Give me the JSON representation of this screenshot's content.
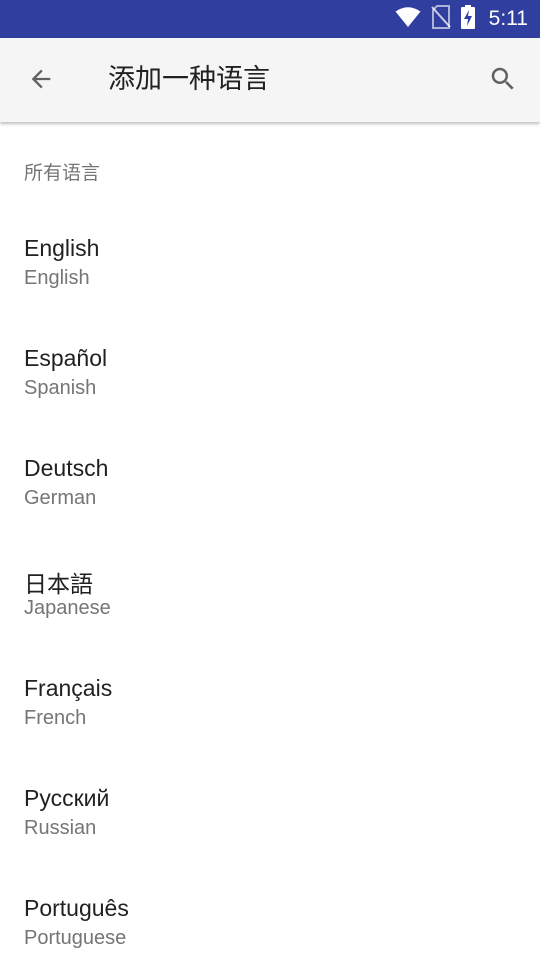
{
  "status_bar": {
    "time": "5:11",
    "icons": [
      "wifi-icon",
      "no-sim-icon",
      "battery-charging-icon"
    ],
    "background": "#303f9f"
  },
  "app_bar": {
    "back_icon": "arrow-back-icon",
    "title": "添加一种语言",
    "search_icon": "search-icon"
  },
  "section": {
    "header": "所有语言"
  },
  "languages": [
    {
      "name": "English",
      "english_name": "English"
    },
    {
      "name": "Español",
      "english_name": "Spanish"
    },
    {
      "name": "Deutsch",
      "english_name": "German"
    },
    {
      "name": "日本語",
      "english_name": "Japanese"
    },
    {
      "name": "Français",
      "english_name": "French"
    },
    {
      "name": "Русский",
      "english_name": "Russian"
    },
    {
      "name": "Português",
      "english_name": "Portuguese"
    }
  ]
}
